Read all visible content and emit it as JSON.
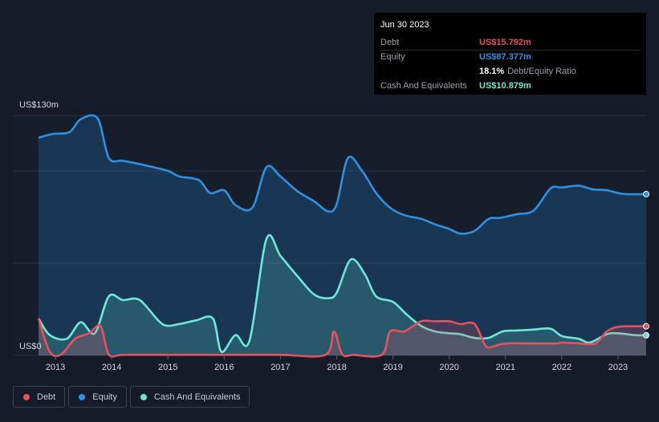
{
  "tooltip": {
    "date": "Jun 30 2023",
    "rows": [
      {
        "label": "Debt",
        "value": "US$15.792m",
        "color": "#e4525e"
      },
      {
        "label": "Equity",
        "value": "US$87.377m",
        "color": "#2f8fe0"
      },
      {
        "label": "",
        "value": "18.1%",
        "extra": "Debt/Equity Ratio",
        "color": "#ffffff"
      },
      {
        "label": "Cash And Equivalents",
        "value": "US$10.879m",
        "color": "#6de8d5"
      }
    ]
  },
  "legend": [
    {
      "name": "Debt",
      "color": "#e4525e"
    },
    {
      "name": "Equity",
      "color": "#2f8fe0"
    },
    {
      "name": "Cash And Equivalents",
      "color": "#6de8d5"
    }
  ],
  "chart_data": {
    "type": "area",
    "ylabel_top": "US$130m",
    "ylabel_bottom": "US$0",
    "ylim": [
      0,
      130
    ],
    "xlim": [
      2012.7,
      2023.5
    ],
    "x_ticks": [
      "2013",
      "2014",
      "2015",
      "2016",
      "2017",
      "2018",
      "2019",
      "2020",
      "2021",
      "2022",
      "2023"
    ],
    "grid": true,
    "legend_position": "bottom-left",
    "series": [
      {
        "name": "Equity",
        "color": "#2f8fe0",
        "x": [
          2012.7,
          2012.95,
          2013.25,
          2013.45,
          2013.75,
          2013.95,
          2014.2,
          2014.6,
          2015.0,
          2015.2,
          2015.55,
          2015.75,
          2016.0,
          2016.2,
          2016.5,
          2016.75,
          2017.0,
          2017.3,
          2017.6,
          2017.85,
          2018.0,
          2018.2,
          2018.45,
          2018.7,
          2018.95,
          2019.2,
          2019.5,
          2019.75,
          2020.0,
          2020.2,
          2020.45,
          2020.7,
          2020.9,
          2021.2,
          2021.5,
          2021.8,
          2022.0,
          2022.3,
          2022.55,
          2022.8,
          2023.1,
          2023.5
        ],
        "values": [
          118,
          120,
          121,
          128,
          128.5,
          107,
          105.5,
          103,
          100,
          97,
          95,
          88,
          89.5,
          81.5,
          80,
          102,
          97,
          89,
          83.5,
          78,
          82,
          107,
          100,
          88,
          80,
          76,
          74,
          71,
          68.5,
          66,
          67.5,
          74,
          74.5,
          76.5,
          78.5,
          90.5,
          91,
          92,
          90,
          89.5,
          87.5,
          87.4
        ]
      },
      {
        "name": "Cash And Equivalents",
        "color": "#6de8d5",
        "x": [
          2012.7,
          2012.9,
          2013.2,
          2013.45,
          2013.7,
          2013.95,
          2014.2,
          2014.5,
          2014.9,
          2015.2,
          2015.5,
          2015.8,
          2015.95,
          2016.2,
          2016.45,
          2016.75,
          2017.0,
          2017.3,
          2017.6,
          2017.85,
          2018.0,
          2018.25,
          2018.5,
          2018.7,
          2019.0,
          2019.25,
          2019.5,
          2019.75,
          2020.0,
          2020.2,
          2020.45,
          2020.7,
          2020.95,
          2021.2,
          2021.5,
          2021.8,
          2022.0,
          2022.3,
          2022.5,
          2022.8,
          2023.0,
          2023.3,
          2023.5
        ],
        "values": [
          20,
          11,
          9,
          18,
          12,
          32,
          30,
          30,
          17,
          17,
          19,
          20,
          2,
          11,
          8,
          63,
          54,
          43,
          33,
          31,
          34,
          52,
          44,
          32,
          29,
          22,
          16,
          13,
          12,
          11.5,
          9.5,
          9.5,
          13,
          13.5,
          14,
          14.5,
          10.5,
          9,
          7,
          11.5,
          12,
          11,
          10.9
        ]
      },
      {
        "name": "Debt",
        "color": "#e4525e",
        "x": [
          2012.7,
          2012.9,
          2013.1,
          2013.35,
          2013.6,
          2013.8,
          2013.95,
          2014.2,
          2015.0,
          2016.0,
          2017.0,
          2017.8,
          2017.95,
          2018.1,
          2018.3,
          2018.8,
          2018.95,
          2019.2,
          2019.5,
          2019.75,
          2020.0,
          2020.2,
          2020.45,
          2020.65,
          2020.8,
          2021.0,
          2021.5,
          2021.9,
          2022.0,
          2022.3,
          2022.6,
          2022.8,
          2023.0,
          2023.3,
          2023.5
        ],
        "values": [
          20,
          2,
          0.5,
          9,
          12,
          16,
          0.5,
          0.3,
          0.3,
          0.3,
          0.3,
          0.3,
          13,
          0.5,
          0.3,
          0.3,
          13,
          13,
          18.5,
          18.5,
          18.5,
          17,
          17,
          5,
          5,
          6.5,
          6.5,
          6.5,
          7,
          6.5,
          6.5,
          13,
          15.5,
          15.8,
          15.8
        ]
      }
    ]
  }
}
